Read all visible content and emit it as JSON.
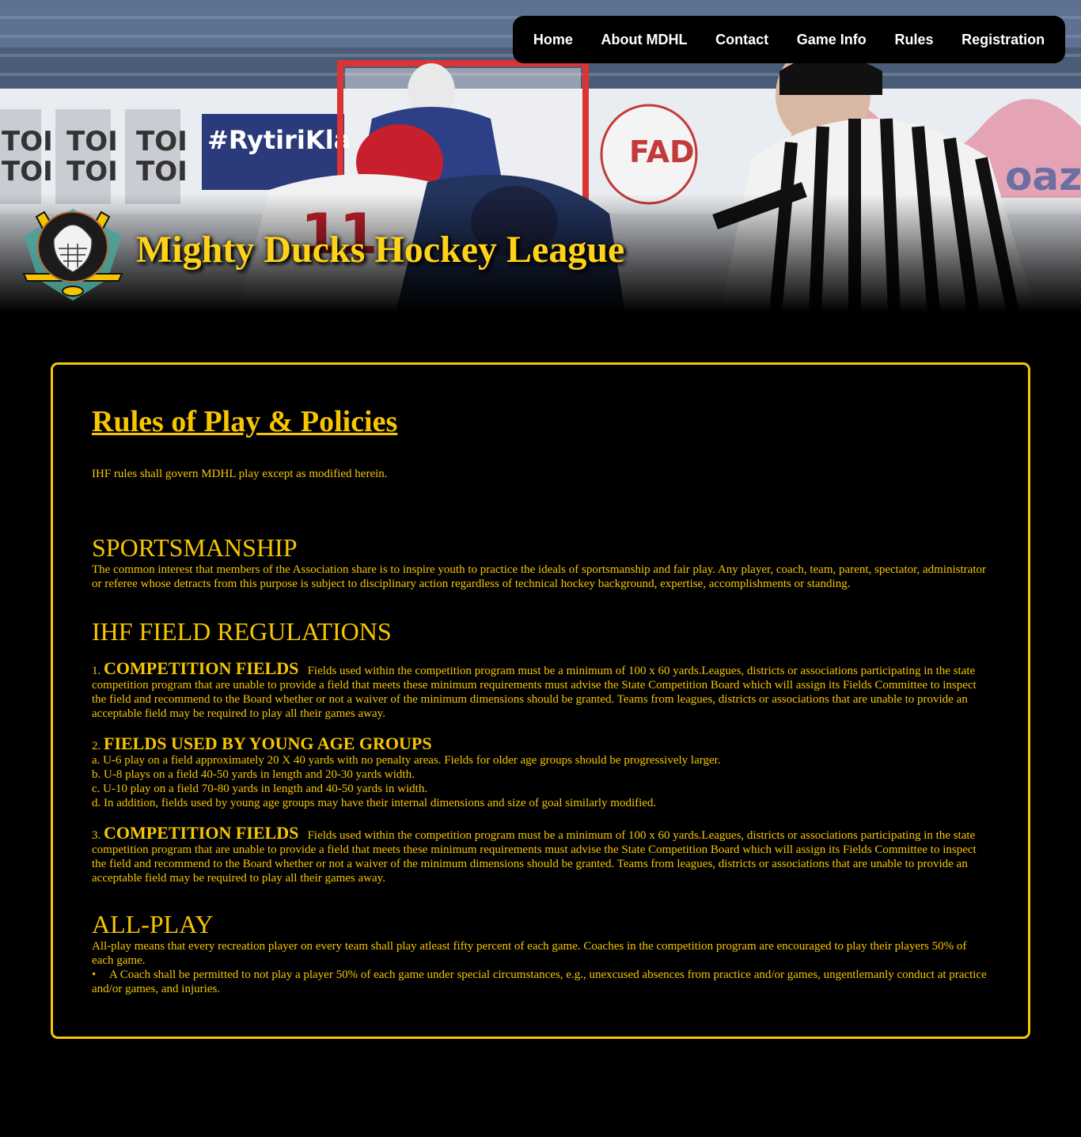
{
  "nav": {
    "items": [
      "Home",
      "About MDHL",
      "Contact",
      "Game Info",
      "Rules",
      "Registration"
    ]
  },
  "site": {
    "title": "Mighty Ducks Hockey League"
  },
  "main": {
    "title": "Rules of Play & Policies",
    "intro": "IHF rules shall govern MDHL play except as modified herein.",
    "sportsmanship": {
      "heading": "SPORTSMANSHIP",
      "text": "The common interest that members of the Association share is to inspire youth to practice the ideals of sportsmanship and fair play. Any player, coach, team, parent, spectator, administrator or referee whose detracts from this purpose is subject to disciplinary action regardless of technical hockey background, expertise, accomplishments or standing."
    },
    "field_regulations": {
      "heading": "IHF FIELD REGULATIONS",
      "item1": {
        "num": "1.",
        "title": "COMPETITION FIELDS",
        "text": "Fields used within the competition program must be a minimum of 100 x 60 yards.Leagues, districts or associations participating in the state competition program that are unable to provide a field that meets these minimum requirements must advise the State Competition Board which will assign its Fields Committee to inspect the field and recommend to the Board whether or not a waiver of the minimum dimensions should be granted. Teams from leagues, districts or associations that are unable to provide an acceptable field may be required to play all their games away."
      },
      "item2": {
        "num": "2.",
        "title": "FIELDS USED BY YOUNG AGE GROUPS",
        "lines": [
          "a. U-6 play on a field approximately 20 X 40 yards with no penalty areas. Fields for older age groups should be progressively larger.",
          "b. U-8 plays on a field 40-50 yards in length and 20-30 yards width.",
          "c. U-10 play on a field 70-80 yards in length and 40-50 yards in width.",
          "d. In addition, fields used by young age groups may have their internal dimensions and size of goal similarly modified."
        ]
      },
      "item3": {
        "num": "3.",
        "title": "COMPETITION FIELDS",
        "text": "Fields used within the competition program must be a minimum of 100 x 60 yards.Leagues, districts or associations participating in the state competition program that are unable to provide a field that meets these minimum requirements must advise the State Competition Board which will assign its Fields Committee to inspect the field and recommend to the Board whether or not a waiver of the minimum dimensions should be granted. Teams from leagues, districts or associations that are unable to provide an acceptable field may be required to play all their games away."
      }
    },
    "all_play": {
      "heading": "ALL-PLAY",
      "text": "All-play means that every recreation player on every team shall play atleast fifty percent of each game. Coaches in the competition program are encouraged to play their players 50% of each game.",
      "bullet": "A Coach shall be permitted to not play a player 50% of each game under special circumstances, e.g., unexcused absences from practice and/or games, ungentlemanly conduct at practice and/or games, and injuries."
    }
  },
  "colors": {
    "accent": "#f7c600",
    "title": "#ffd21a",
    "background": "#000000",
    "nav_text": "#ffffff"
  }
}
